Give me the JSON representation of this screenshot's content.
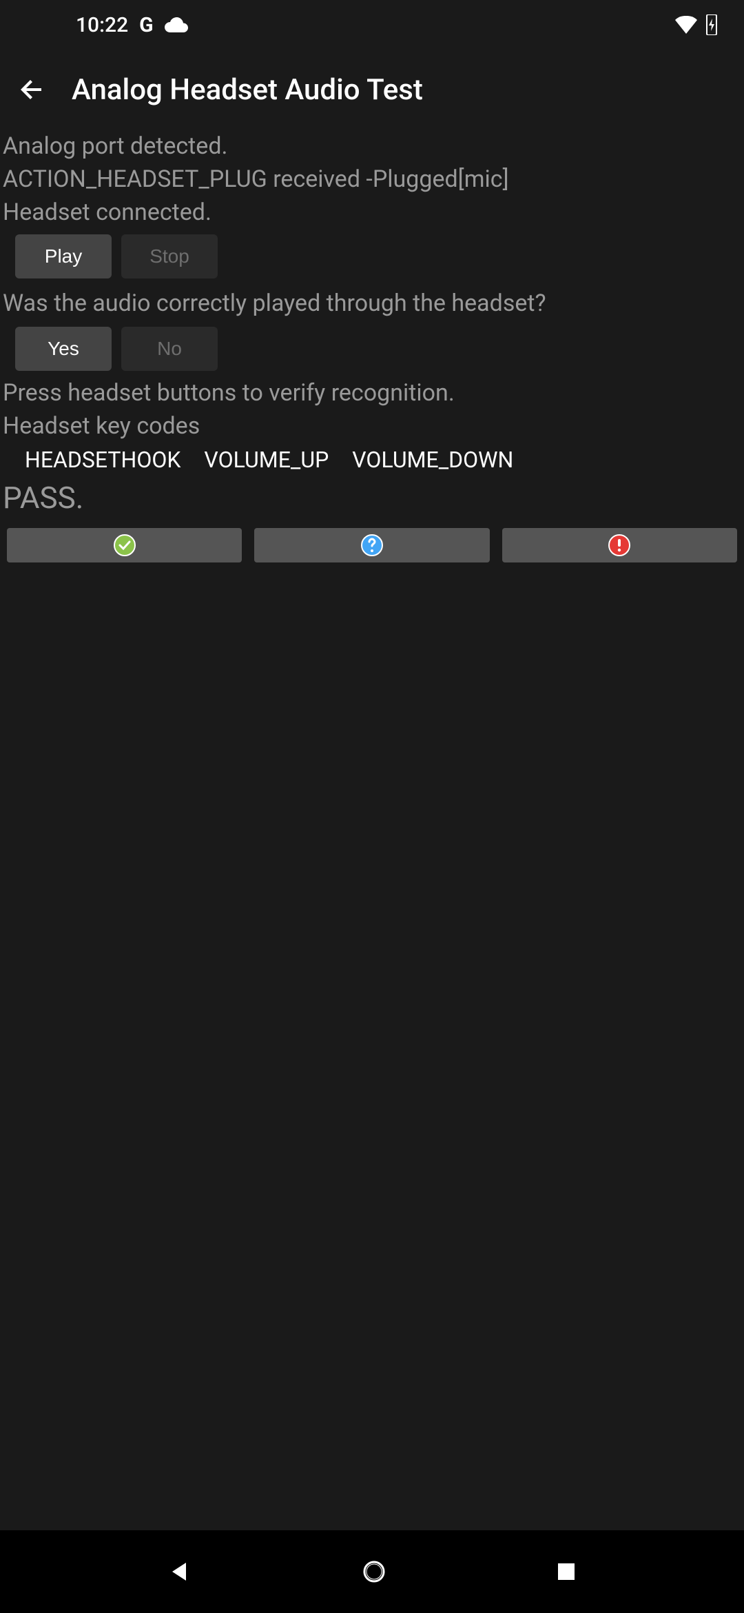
{
  "statusbar": {
    "time": "10:22"
  },
  "appbar": {
    "title": "Analog Headset Audio Test"
  },
  "body": {
    "line1": "Analog port detected.",
    "line2": "ACTION_HEADSET_PLUG received -Plugged[mic]",
    "line3": "Headset connected.",
    "play_label": "Play",
    "stop_label": "Stop",
    "question": "Was the audio correctly played through the headset?",
    "yes_label": "Yes",
    "no_label": "No",
    "instruction": "Press headset buttons to verify recognition.",
    "keycodes_label": "Headset key codes",
    "keycodes": [
      "HEADSETHOOK",
      "VOLUME_UP",
      "VOLUME_DOWN"
    ],
    "result": "PASS."
  },
  "colors": {
    "pass_icon": "#8bc34a",
    "info_icon": "#42a5f5",
    "fail_icon": "#e53935"
  }
}
